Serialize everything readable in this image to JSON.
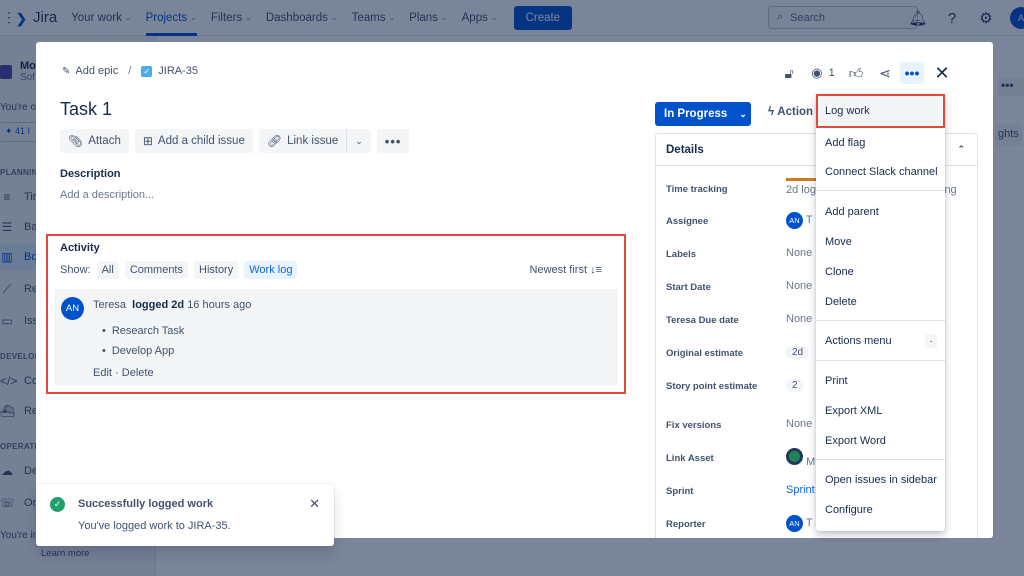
{
  "topnav": {
    "app_name": "Jira",
    "items": [
      {
        "label": "Your work",
        "active": false
      },
      {
        "label": "Projects",
        "active": true
      },
      {
        "label": "Filters",
        "active": false
      },
      {
        "label": "Dashboards",
        "active": false
      },
      {
        "label": "Teams",
        "active": false
      },
      {
        "label": "Plans",
        "active": false
      },
      {
        "label": "Apps",
        "active": false
      }
    ],
    "create_label": "Create",
    "search_placeholder": "Search",
    "avatar_initials": "A"
  },
  "sidebar": {
    "project_name": "Mo",
    "project_type": "Sof",
    "plan_notice": "You're on",
    "pill_label": "41 I",
    "sections": [
      {
        "label": "PLANNING",
        "items": [
          {
            "icon": "timeline-icon",
            "label": "Tir"
          },
          {
            "icon": "backlog-icon",
            "label": "Ba"
          },
          {
            "icon": "board-icon",
            "label": "Bo",
            "active": true
          },
          {
            "icon": "reports-icon",
            "label": "Re"
          },
          {
            "icon": "issues-icon",
            "label": "Iss"
          }
        ]
      },
      {
        "label": "DEVELOP",
        "items": [
          {
            "icon": "code-icon",
            "label": "Co"
          },
          {
            "icon": "releases-icon",
            "label": "Re"
          }
        ]
      },
      {
        "label": "OPERATIO",
        "items": [
          {
            "icon": "deployments-icon",
            "label": "De"
          },
          {
            "icon": "on-call-icon",
            "label": "On"
          }
        ]
      }
    ],
    "footer_notice": "You're in a",
    "learn_more": "Learn more"
  },
  "issue": {
    "add_epic": "Add epic",
    "separator": "/",
    "key": "JIRA-35",
    "title": "Task 1",
    "actions": {
      "attach": "Attach",
      "add_child": "Add a child issue",
      "link_issue": "Link issue",
      "more": "•••"
    },
    "description_heading": "Description",
    "description_placeholder": "Add a description...",
    "watchers_count": "1"
  },
  "activity": {
    "heading": "Activity",
    "show_label": "Show:",
    "filters": [
      {
        "label": "All",
        "active": false
      },
      {
        "label": "Comments",
        "active": false
      },
      {
        "label": "History",
        "active": false
      },
      {
        "label": "Work log",
        "active": true
      }
    ],
    "sort_label": "Newest first",
    "entry": {
      "avatar": "AN",
      "author": "Teresa",
      "action": "logged",
      "amount": "2d",
      "when": "16 hours ago",
      "items": [
        "Research Task",
        "Develop App"
      ],
      "edit": "Edit",
      "dot": "·",
      "delete": "Delete"
    }
  },
  "status": {
    "label": "In Progress",
    "actions_label": "Action"
  },
  "details": {
    "heading": "Details",
    "time_tracking": {
      "label": "Time tracking",
      "value": "2d log",
      "logged_fraction": 0.5,
      "remaining_text": "ing"
    },
    "rows": [
      {
        "label": "Assignee",
        "value": "T",
        "avatar": "AN"
      },
      {
        "label": "Labels",
        "value": "None"
      },
      {
        "label": "Start Date",
        "value": "None"
      },
      {
        "label": "Teresa Due date",
        "value": "None"
      },
      {
        "label": "Original estimate",
        "value": "2d"
      },
      {
        "label": "Story point estimate",
        "value": "2"
      },
      {
        "label": "Fix versions",
        "value": "None"
      },
      {
        "label": "Link Asset",
        "value": "M"
      },
      {
        "label": "Sprint",
        "value": "Sprint"
      },
      {
        "label": "Reporter",
        "value": "T",
        "avatar": "AN"
      }
    ]
  },
  "menu": {
    "groups": [
      [
        "Log work",
        "Add flag",
        "Connect Slack channel"
      ],
      [
        "Add parent",
        "Move",
        "Clone",
        "Delete"
      ],
      [
        "Actions menu"
      ],
      [
        "Print",
        "Export XML",
        "Export Word"
      ],
      [
        "Open issues in sidebar",
        "Configure"
      ]
    ],
    "actions_shortcut": ".",
    "highlighted": "Log work"
  },
  "background": {
    "insights_partial": "ghts",
    "more": "•••"
  },
  "toast": {
    "title": "Successfully logged work",
    "message": "You've logged work to JIRA-35."
  },
  "colors": {
    "brand": "#0052cc",
    "highlight_border": "#e2483d",
    "success": "#22a06b",
    "time_logged": "#cf7b1a"
  }
}
